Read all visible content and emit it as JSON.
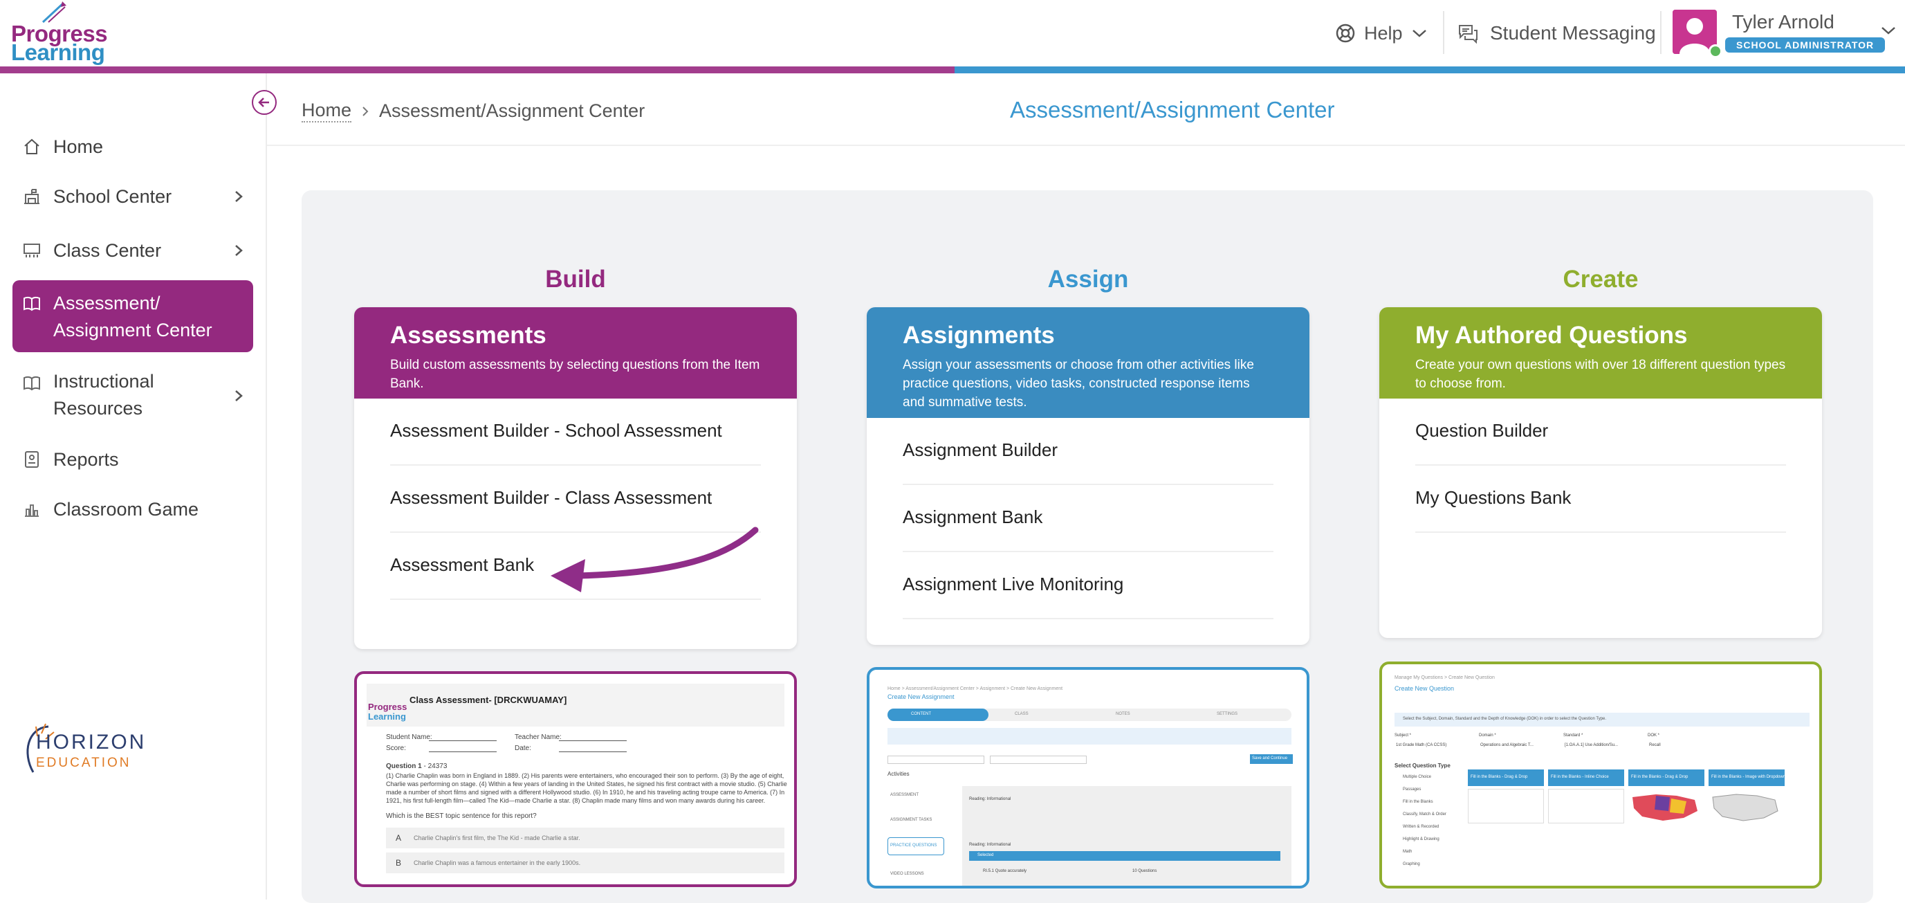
{
  "header": {
    "logo_line1": "Progress",
    "logo_line2": "Learning",
    "help_label": "Help",
    "messaging_label": "Student Messaging",
    "user_name": "Tyler Arnold",
    "user_role": "SCHOOL ADMINISTRATOR"
  },
  "colors": {
    "brand_purple": "#94297f",
    "brand_blue": "#3a97cf",
    "brand_green": "#8fae2e",
    "page_title": "#3a97cf"
  },
  "sidebar": {
    "items": [
      {
        "label": "Home",
        "icon": "home-icon"
      },
      {
        "label": "School Center",
        "icon": "school-icon"
      },
      {
        "label": "Class Center",
        "icon": "classroom-icon"
      },
      {
        "label": "Assessment/\nAssignment Center",
        "icon": "book-open-icon",
        "active": true
      },
      {
        "label": "Instructional\nResources",
        "icon": "book-icon"
      },
      {
        "label": "Reports",
        "icon": "report-icon"
      },
      {
        "label": "Classroom Game",
        "icon": "game-icon"
      }
    ],
    "partner_logo_line1": "HORIZON",
    "partner_logo_line2": "EDUCATION"
  },
  "breadcrumb": {
    "home": "Home",
    "current": "Assessment/Assignment Center"
  },
  "page_title": "Assessment/Assignment Center",
  "columns": [
    {
      "heading": "Build",
      "card_title": "Assessments",
      "card_desc": "Build custom assessments by selecting questions from the Item Bank.",
      "links": [
        "Assessment Builder - School Assessment",
        "Assessment Builder - Class Assessment",
        "Assessment Bank"
      ]
    },
    {
      "heading": "Assign",
      "card_title": "Assignments",
      "card_desc": "Assign your assessments or choose from other activities like practice questions, video tasks, constructed response items and summative tests.",
      "links": [
        "Assignment Builder",
        "Assignment Bank",
        "Assignment Live Monitoring"
      ]
    },
    {
      "heading": "Create",
      "card_title": "My Authored Questions",
      "card_desc": "Create your own questions with over 18 different question types to choose from.",
      "links": [
        "Question Builder",
        "My Questions Bank"
      ]
    }
  ],
  "previews": {
    "build": {
      "title": "Class Assessment- [DRCKWUAMAY]",
      "logo_line1": "Progress",
      "logo_line2": "Learning",
      "student_name": "Student Name:",
      "teacher_name": "Teacher Name:",
      "score": "Score:",
      "date": "Date:",
      "question": "Question 1",
      "question_num": " - 24373",
      "passage_lines": [
        "(1) Charlie Chaplin was born in England in 1889. (2) His parents were entertainers, who encouraged their son to perform. (3) By the age of eight,",
        "Charlie was performing on stage. (4) Within a few years of landing in the United States, he signed his first contract with a movie studio. (5) Charlie",
        "made a number of short films and signed with a different Hollywood studio. (6) In 1910, he and his traveling acting troupe came to America. (7) In",
        "1921, his first full-length film—called The Kid—made Charlie a star. (8) Chaplin made many films and won many awards during his career."
      ],
      "prompt": "Which is the BEST topic sentence for this report?",
      "option_a_letter": "A",
      "option_a": "Charlie Chaplin's first film, the The Kid - made Charlie a star.",
      "option_b_letter": "B",
      "option_b": "Charlie Chaplin was a famous entertainer in the early 1900s."
    },
    "assign": {
      "crumb": "Home > Assessment/Assignment Center > Assignment > Create New Assignment",
      "title": "Create New Assignment",
      "step1": "CONTENT",
      "step2": "CLASS",
      "step3": "NOTES",
      "step4": "SETTINGS",
      "save_label": "Save and Continue",
      "activities": "Activities",
      "tab1": "ASSESSMENT",
      "tab2": "ASSIGNMENT TASKS",
      "tab3": "PRACTICE QUESTIONS",
      "tab4": "VIDEO LESSONS",
      "domain": "Reading: Informational",
      "selected": "Selected",
      "standard": "RI.5.1 Quote accurately",
      "count": "10 Questions"
    },
    "create": {
      "crumb": "Manage My Questions > Create New Question",
      "title": "Create New Question",
      "info": "Select the Subject, Domain, Standard and the Depth of Knowledge (DOK) in order to select the Question Type.",
      "subject_label": "Subject *",
      "subject_value": "1st Grade Math (CA CCSS)",
      "domain_label": "Domain *",
      "domain_value": "Operations and Algebraic T...",
      "standard_label": "Standard *",
      "standard_value": "[1.OA.A.1] Use Addition/Su...",
      "dok_label": "DOK *",
      "dok_value": "Recall",
      "select_type": "Select Question Type",
      "types": [
        "Multiple Choice",
        "Passages",
        "Fill in the Blanks",
        "Classify, Match & Order",
        "Written & Recorded",
        "Highlight & Drawing",
        "Math",
        "Graphing"
      ],
      "tiles": [
        "Fill in the Blanks - Drag & Drop",
        "Fill in the Blanks - Inline Choice",
        "Fill in the Blanks - Drag & Drop",
        "Fill in the Blanks - Image with Dropdown"
      ]
    }
  }
}
